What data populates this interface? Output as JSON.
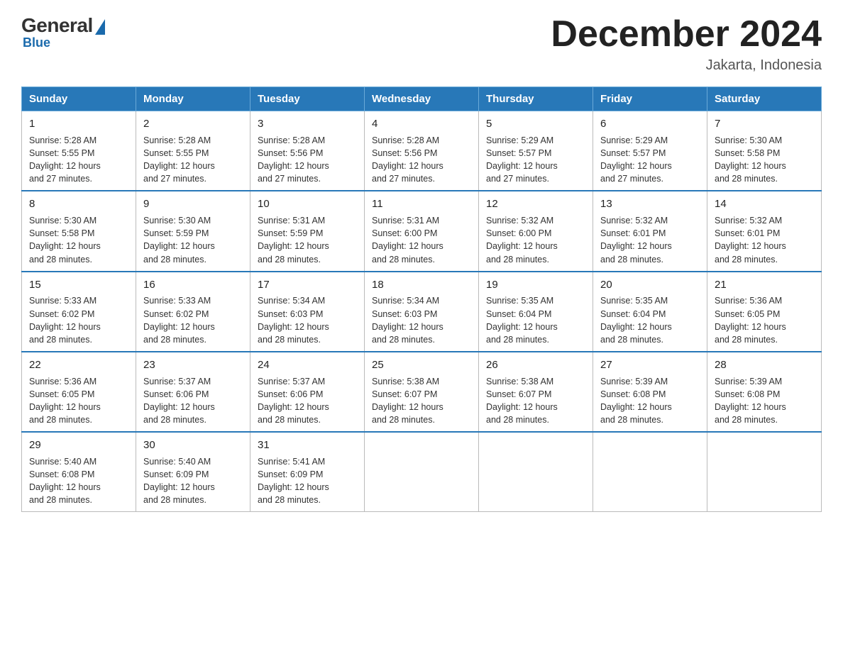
{
  "header": {
    "logo": {
      "general": "General",
      "blue": "Blue"
    },
    "title": "December 2024",
    "location": "Jakarta, Indonesia"
  },
  "weekdays": [
    "Sunday",
    "Monday",
    "Tuesday",
    "Wednesday",
    "Thursday",
    "Friday",
    "Saturday"
  ],
  "weeks": [
    [
      {
        "day": "1",
        "sunrise": "5:28 AM",
        "sunset": "5:55 PM",
        "daylight": "12 hours and 27 minutes."
      },
      {
        "day": "2",
        "sunrise": "5:28 AM",
        "sunset": "5:55 PM",
        "daylight": "12 hours and 27 minutes."
      },
      {
        "day": "3",
        "sunrise": "5:28 AM",
        "sunset": "5:56 PM",
        "daylight": "12 hours and 27 minutes."
      },
      {
        "day": "4",
        "sunrise": "5:28 AM",
        "sunset": "5:56 PM",
        "daylight": "12 hours and 27 minutes."
      },
      {
        "day": "5",
        "sunrise": "5:29 AM",
        "sunset": "5:57 PM",
        "daylight": "12 hours and 27 minutes."
      },
      {
        "day": "6",
        "sunrise": "5:29 AM",
        "sunset": "5:57 PM",
        "daylight": "12 hours and 27 minutes."
      },
      {
        "day": "7",
        "sunrise": "5:30 AM",
        "sunset": "5:58 PM",
        "daylight": "12 hours and 28 minutes."
      }
    ],
    [
      {
        "day": "8",
        "sunrise": "5:30 AM",
        "sunset": "5:58 PM",
        "daylight": "12 hours and 28 minutes."
      },
      {
        "day": "9",
        "sunrise": "5:30 AM",
        "sunset": "5:59 PM",
        "daylight": "12 hours and 28 minutes."
      },
      {
        "day": "10",
        "sunrise": "5:31 AM",
        "sunset": "5:59 PM",
        "daylight": "12 hours and 28 minutes."
      },
      {
        "day": "11",
        "sunrise": "5:31 AM",
        "sunset": "6:00 PM",
        "daylight": "12 hours and 28 minutes."
      },
      {
        "day": "12",
        "sunrise": "5:32 AM",
        "sunset": "6:00 PM",
        "daylight": "12 hours and 28 minutes."
      },
      {
        "day": "13",
        "sunrise": "5:32 AM",
        "sunset": "6:01 PM",
        "daylight": "12 hours and 28 minutes."
      },
      {
        "day": "14",
        "sunrise": "5:32 AM",
        "sunset": "6:01 PM",
        "daylight": "12 hours and 28 minutes."
      }
    ],
    [
      {
        "day": "15",
        "sunrise": "5:33 AM",
        "sunset": "6:02 PM",
        "daylight": "12 hours and 28 minutes."
      },
      {
        "day": "16",
        "sunrise": "5:33 AM",
        "sunset": "6:02 PM",
        "daylight": "12 hours and 28 minutes."
      },
      {
        "day": "17",
        "sunrise": "5:34 AM",
        "sunset": "6:03 PM",
        "daylight": "12 hours and 28 minutes."
      },
      {
        "day": "18",
        "sunrise": "5:34 AM",
        "sunset": "6:03 PM",
        "daylight": "12 hours and 28 minutes."
      },
      {
        "day": "19",
        "sunrise": "5:35 AM",
        "sunset": "6:04 PM",
        "daylight": "12 hours and 28 minutes."
      },
      {
        "day": "20",
        "sunrise": "5:35 AM",
        "sunset": "6:04 PM",
        "daylight": "12 hours and 28 minutes."
      },
      {
        "day": "21",
        "sunrise": "5:36 AM",
        "sunset": "6:05 PM",
        "daylight": "12 hours and 28 minutes."
      }
    ],
    [
      {
        "day": "22",
        "sunrise": "5:36 AM",
        "sunset": "6:05 PM",
        "daylight": "12 hours and 28 minutes."
      },
      {
        "day": "23",
        "sunrise": "5:37 AM",
        "sunset": "6:06 PM",
        "daylight": "12 hours and 28 minutes."
      },
      {
        "day": "24",
        "sunrise": "5:37 AM",
        "sunset": "6:06 PM",
        "daylight": "12 hours and 28 minutes."
      },
      {
        "day": "25",
        "sunrise": "5:38 AM",
        "sunset": "6:07 PM",
        "daylight": "12 hours and 28 minutes."
      },
      {
        "day": "26",
        "sunrise": "5:38 AM",
        "sunset": "6:07 PM",
        "daylight": "12 hours and 28 minutes."
      },
      {
        "day": "27",
        "sunrise": "5:39 AM",
        "sunset": "6:08 PM",
        "daylight": "12 hours and 28 minutes."
      },
      {
        "day": "28",
        "sunrise": "5:39 AM",
        "sunset": "6:08 PM",
        "daylight": "12 hours and 28 minutes."
      }
    ],
    [
      {
        "day": "29",
        "sunrise": "5:40 AM",
        "sunset": "6:08 PM",
        "daylight": "12 hours and 28 minutes."
      },
      {
        "day": "30",
        "sunrise": "5:40 AM",
        "sunset": "6:09 PM",
        "daylight": "12 hours and 28 minutes."
      },
      {
        "day": "31",
        "sunrise": "5:41 AM",
        "sunset": "6:09 PM",
        "daylight": "12 hours and 28 minutes."
      },
      null,
      null,
      null,
      null
    ]
  ],
  "labels": {
    "sunrise": "Sunrise:",
    "sunset": "Sunset:",
    "daylight": "Daylight:"
  }
}
